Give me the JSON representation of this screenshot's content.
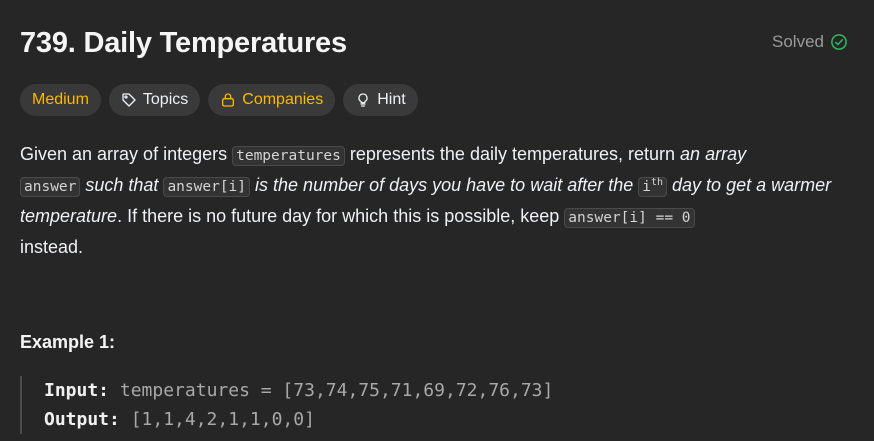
{
  "problem": {
    "title": "739. Daily Temperatures",
    "status": "Solved"
  },
  "tags": {
    "difficulty": "Medium",
    "topics": "Topics",
    "companies": "Companies",
    "hint": "Hint"
  },
  "description": {
    "p1": "Given an array of integers ",
    "c1": "temperatures",
    "p2": " represents the daily temperatures, return ",
    "i1": "an array",
    "c2": "answer",
    "i2": " such that ",
    "c3": "answer[i]",
    "i3": " is the number of days you have to wait after the ",
    "c4_base": "i",
    "c4_sup": "th",
    "i4": " day to get a warmer temperature",
    "p3": ". If there is no future day for which this is possible, keep ",
    "c5": "answer[i] == 0",
    "p4": "instead."
  },
  "example1": {
    "title": "Example 1:",
    "input_label": "Input:",
    "input_value": "temperatures = [73,74,75,71,69,72,76,73]",
    "output_label": "Output:",
    "output_value": "[1,1,4,2,1,1,0,0]"
  },
  "colors": {
    "background": "#262626",
    "medium": "#ffb800",
    "solved_check": "#2cbb5d"
  },
  "icons": {
    "solved": "check-circle-icon",
    "topics": "tag-icon",
    "companies": "lock-icon",
    "hint": "lightbulb-icon"
  }
}
